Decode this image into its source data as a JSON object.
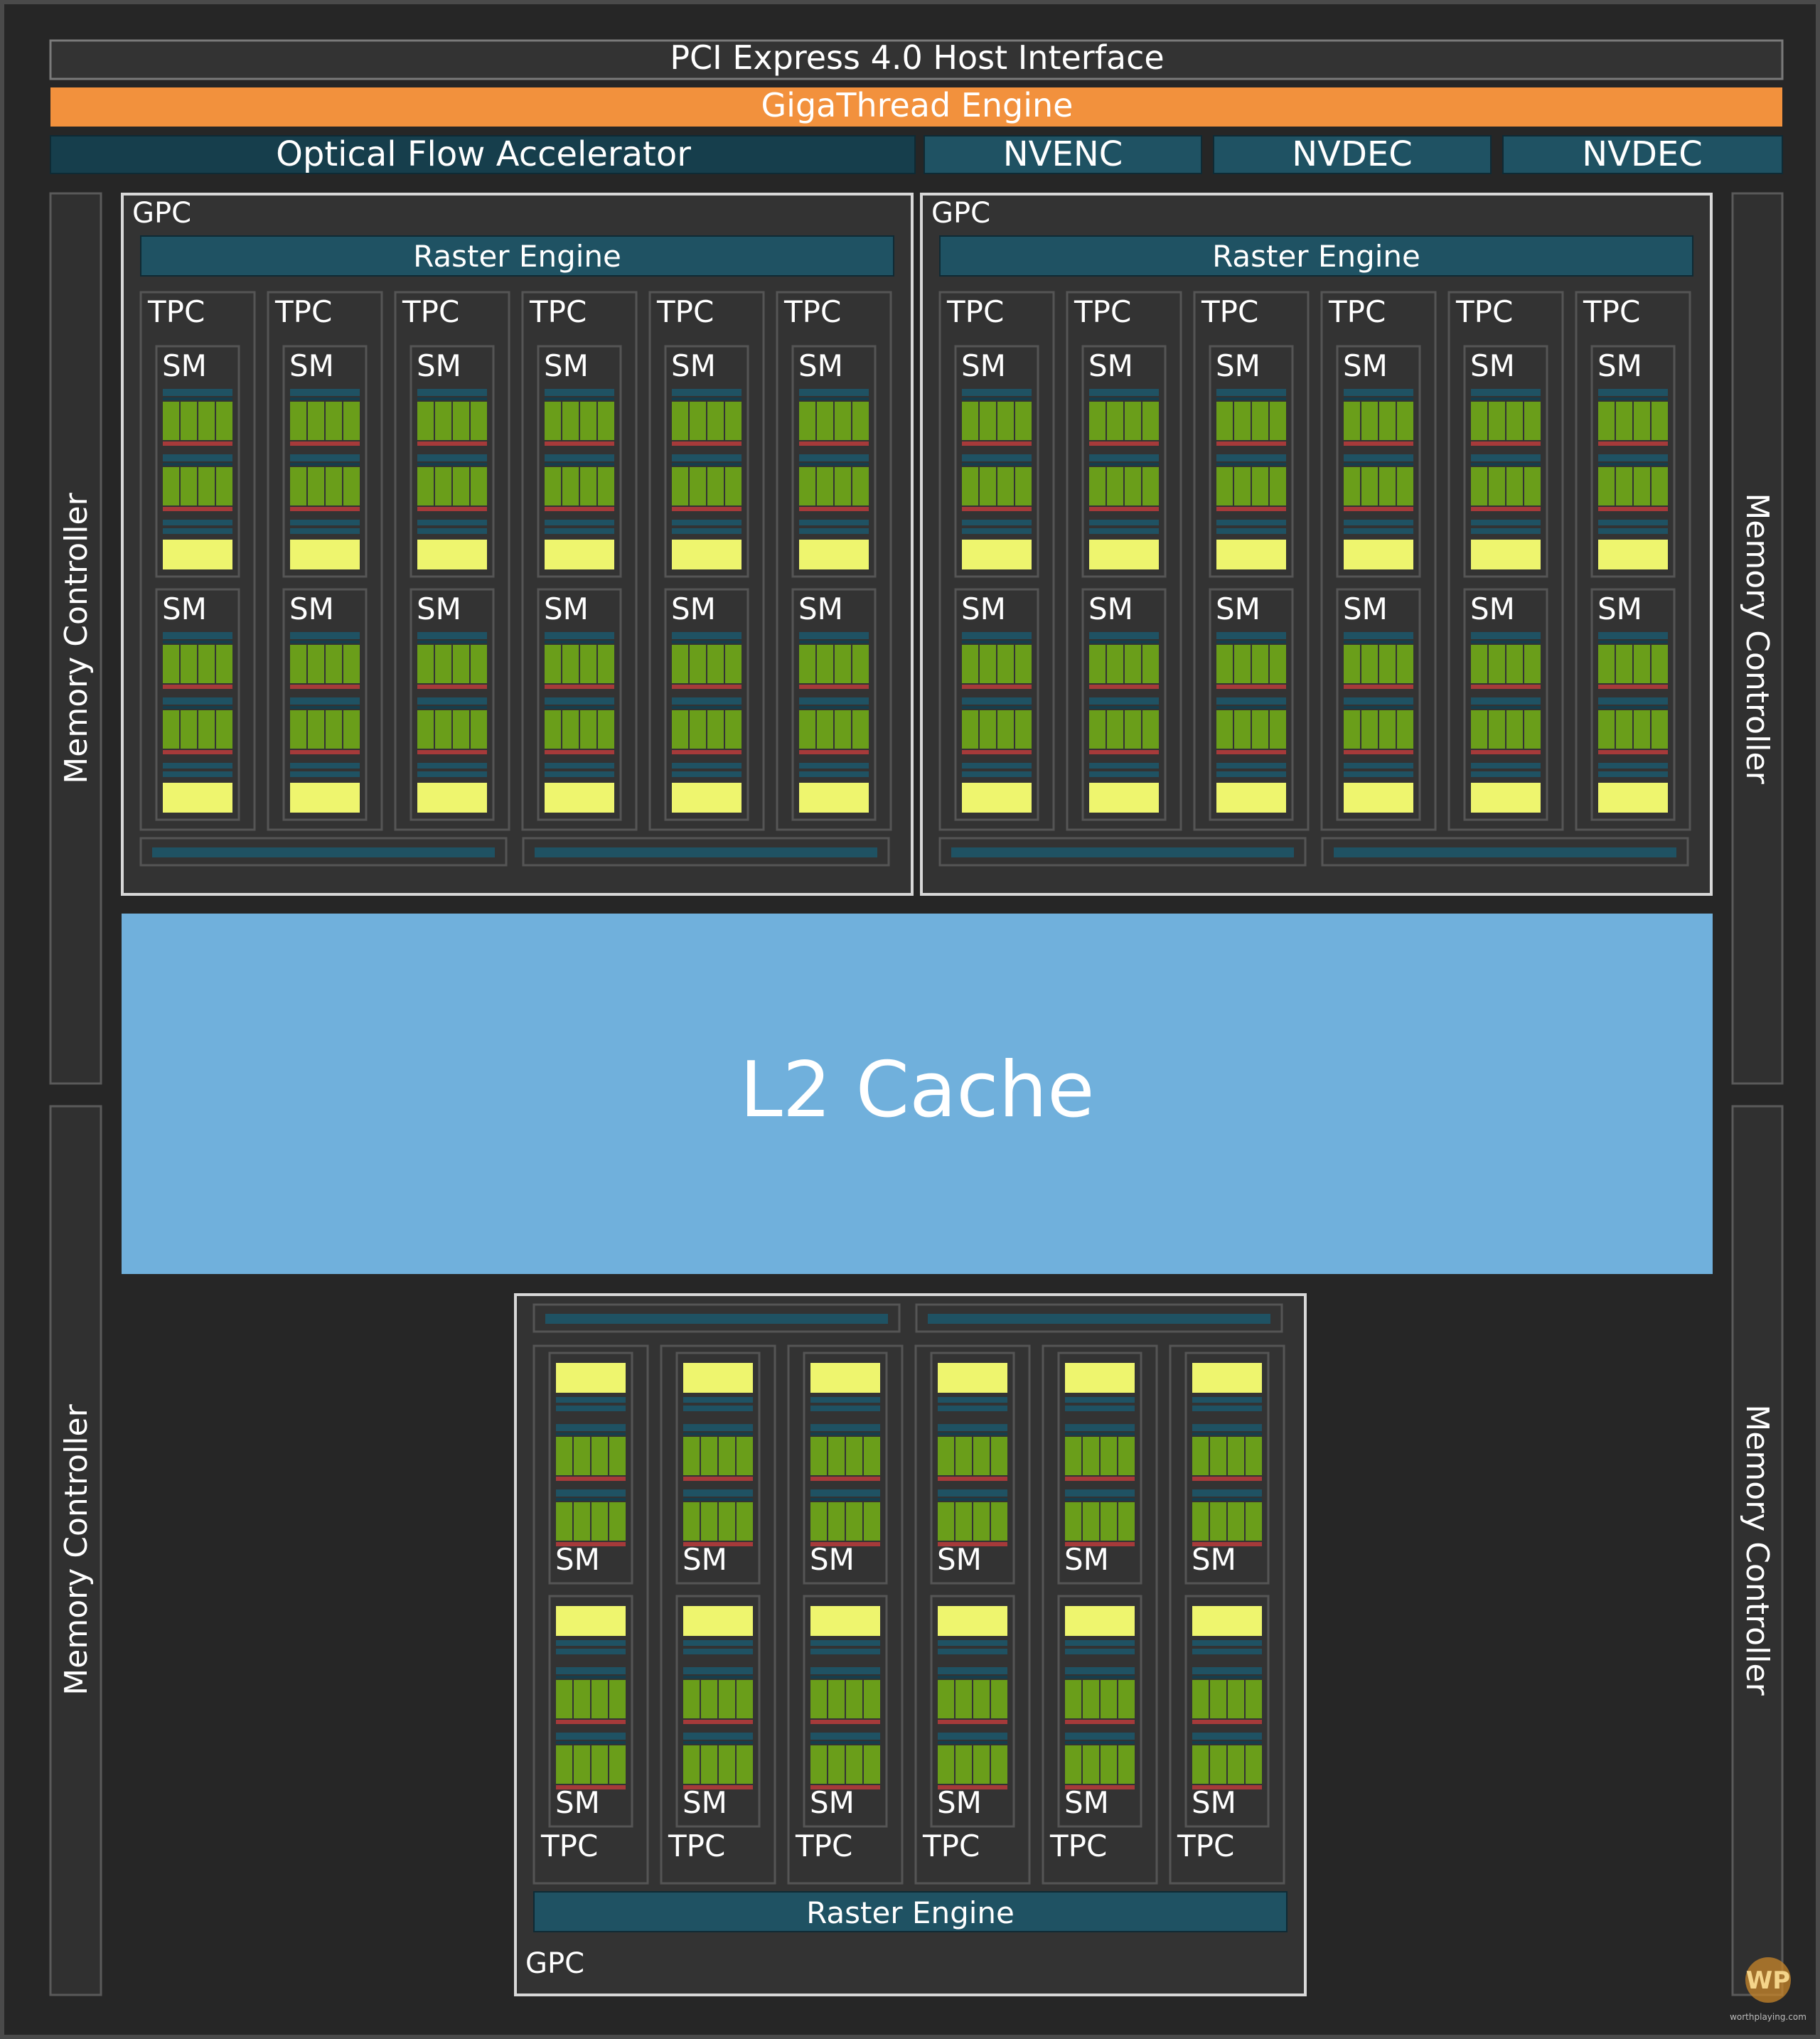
{
  "top_bars": {
    "pci": "PCI Express 4.0 Host Interface",
    "gigathread": "GigaThread Engine",
    "ofa": "Optical Flow Accelerator",
    "nvenc": "NVENC",
    "nvdec_1": "NVDEC",
    "nvdec_2": "NVDEC"
  },
  "memory_controller_label": "Memory Controller",
  "l2_label": "L2 Cache",
  "gpc": {
    "label": "GPC",
    "raster_label": "Raster Engine",
    "tpc_label": "TPC",
    "sm_label": "SM"
  },
  "gpc_layout": {
    "count": 3,
    "tpcs_per_gpc": 6,
    "sms_per_tpc": 2
  },
  "watermark": {
    "logo_text": "WP",
    "caption": "worthplaying.com"
  },
  "colors": {
    "background": "#262626",
    "frame": "#4a4a4a",
    "gpc_fill": "#333333",
    "gpc_border": "#d8d8d8",
    "orange": "#f2913d",
    "teal": "#1f5263",
    "teal_dark": "#163e4c",
    "l2": "#70b0dc",
    "green": "#6a9e1a",
    "yellow": "#eef56e",
    "red": "#a63a3a"
  }
}
